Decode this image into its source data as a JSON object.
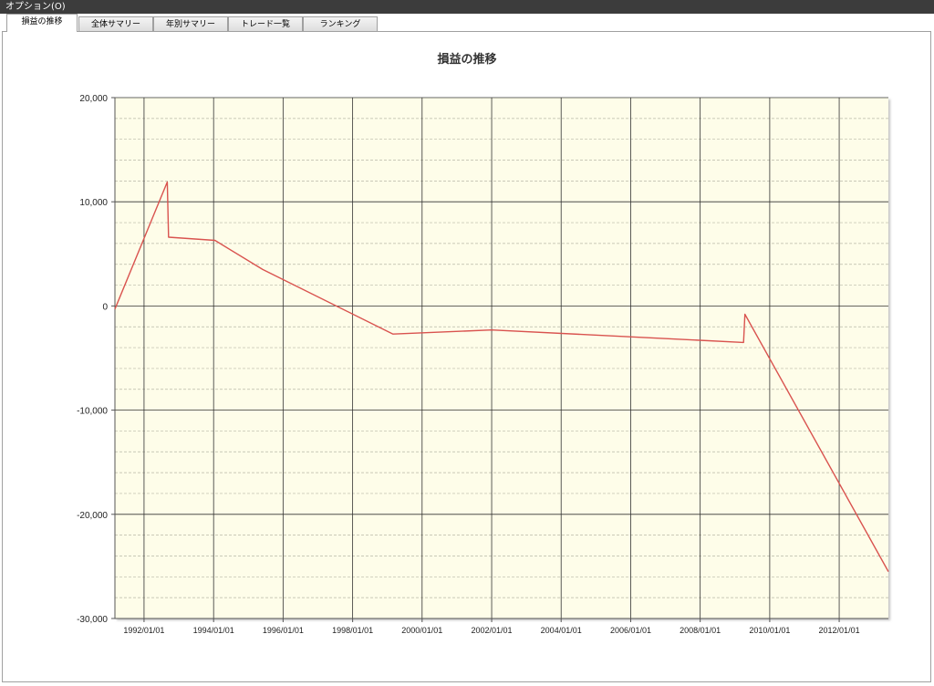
{
  "menu": {
    "options_label": "オプション(O)"
  },
  "tabs": [
    {
      "label": "損益の推移",
      "active": true
    },
    {
      "label": "全体サマリー",
      "active": false
    },
    {
      "label": "年別サマリー",
      "active": false
    },
    {
      "label": "トレード一覧",
      "active": false
    },
    {
      "label": "ランキング",
      "active": false
    }
  ],
  "chart_data": {
    "type": "line",
    "title": "損益の推移",
    "xlabel": "",
    "ylabel": "",
    "xlim": [
      "1991-03-01",
      "2013-06-01"
    ],
    "ylim": [
      -30000,
      20000
    ],
    "y_ticks": [
      "20,000",
      "10,000",
      "0",
      "-10,000",
      "-20,000",
      "-30,000"
    ],
    "y_tick_values": [
      20000,
      10000,
      0,
      -10000,
      -20000,
      -30000
    ],
    "x_ticks": [
      "1992/01/01",
      "1994/01/01",
      "1996/01/01",
      "1998/01/01",
      "2000/01/01",
      "2002/01/01",
      "2004/01/01",
      "2006/01/01",
      "2008/01/01",
      "2010/01/01",
      "2012/01/01"
    ],
    "x_tick_dates": [
      "1992-01-01",
      "1994-01-01",
      "1996-01-01",
      "1998-01-01",
      "2000-01-01",
      "2002-01-01",
      "2004-01-01",
      "2006-01-01",
      "2008-01-01",
      "2010-01-01",
      "2012-01-01"
    ],
    "grid": true,
    "background_color": "#fefde9",
    "series": [
      {
        "color": "#d9534f",
        "points": [
          [
            "1991-03-01",
            -300
          ],
          [
            "1992-09-01",
            11900
          ],
          [
            "1992-09-15",
            6600
          ],
          [
            "1994-01-15",
            6300
          ],
          [
            "1995-06-01",
            3500
          ],
          [
            "1999-03-01",
            -2700
          ],
          [
            "2002-01-01",
            -2300
          ],
          [
            "2009-04-01",
            -3500
          ],
          [
            "2009-04-15",
            -800
          ],
          [
            "2013-06-01",
            -25500
          ]
        ]
      }
    ]
  }
}
